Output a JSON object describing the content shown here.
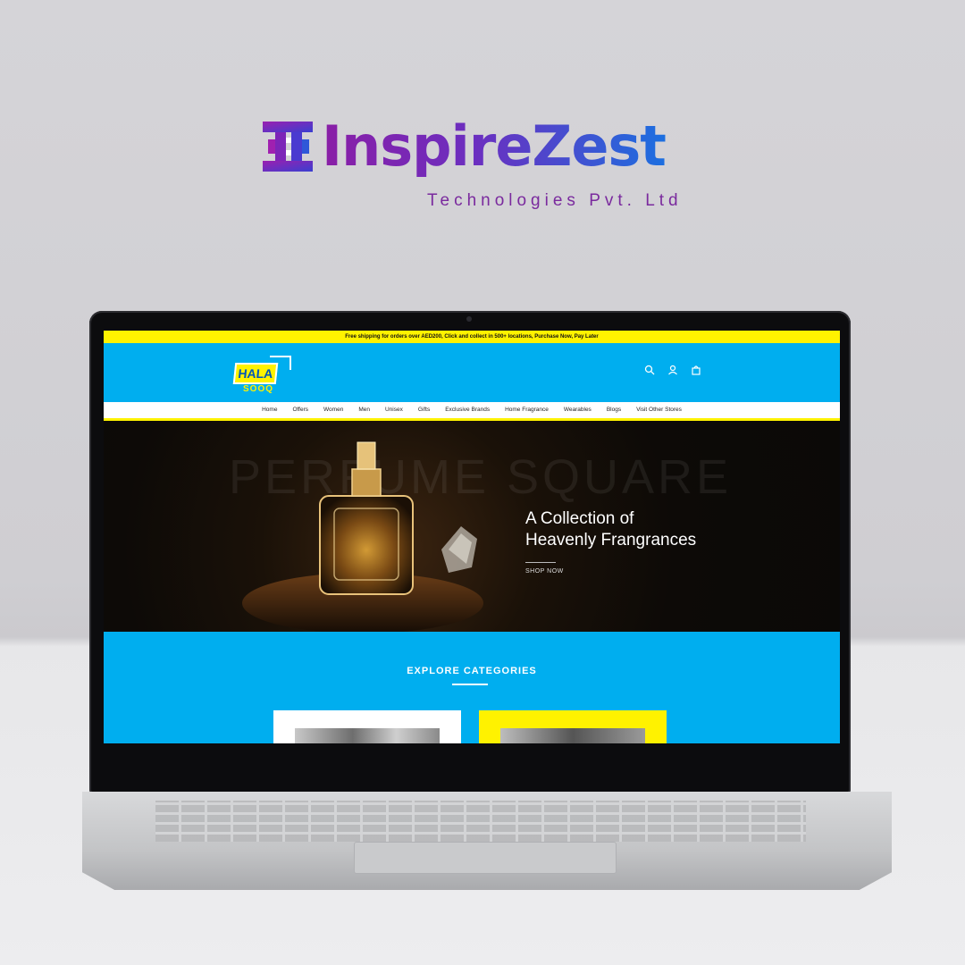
{
  "brand": {
    "name": "InspireZest",
    "subtitle": "Technologies Pvt. Ltd",
    "gradient_start": "#8a1ea6",
    "gradient_end": "#1c6fe0"
  },
  "website": {
    "promo_bar": "Free shipping for orders over AED200, Click and collect in 500+ locations, Purchase Now, Pay Later",
    "logo": {
      "top": "HALA",
      "bottom": "SOOQ"
    },
    "header_icons": [
      "search-icon",
      "account-icon",
      "cart-icon"
    ],
    "nav": [
      "Home",
      "Offers",
      "Women",
      "Men",
      "Unisex",
      "Gifts",
      "Exclusive Brands",
      "Home Fragrance",
      "Wearables",
      "Blogs",
      "Visit Other Stores"
    ],
    "hero": {
      "background_text": "PERFUME SQUARE",
      "title_line1": "A Collection of",
      "title_line2": "Heavenly Frangrances",
      "cta": "SHOP NOW"
    },
    "explore": {
      "title": "EXPLORE CATEGORIES"
    },
    "colors": {
      "primary": "#00aeef",
      "accent": "#fff200"
    }
  }
}
